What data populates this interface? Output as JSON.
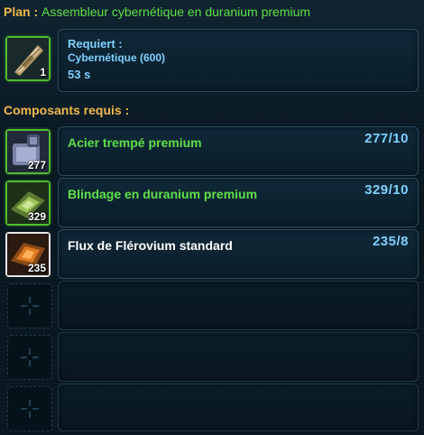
{
  "header": {
    "label": "Plan :",
    "name": "Assembleur cybernétique en duranium premium"
  },
  "recipe": {
    "quantity": "1",
    "requires_label": "Requiert :",
    "skill": "Cybernétique (600)",
    "time": "53 s"
  },
  "components_heading": "Composants requis :",
  "components": [
    {
      "name": "Acier trempé premium",
      "qty": "277",
      "count": "277/10",
      "quality": "premium"
    },
    {
      "name": "Blindage en duranium premium",
      "qty": "329",
      "count": "329/10",
      "quality": "premium"
    },
    {
      "name": "Flux de Flérovium standard",
      "qty": "235",
      "count": "235/8",
      "quality": "standard"
    }
  ],
  "empty_slots": 3,
  "colors": {
    "heading_gold": "#f2b84a",
    "name_green": "#5ee04a",
    "count_blue": "#7ed0ff"
  }
}
